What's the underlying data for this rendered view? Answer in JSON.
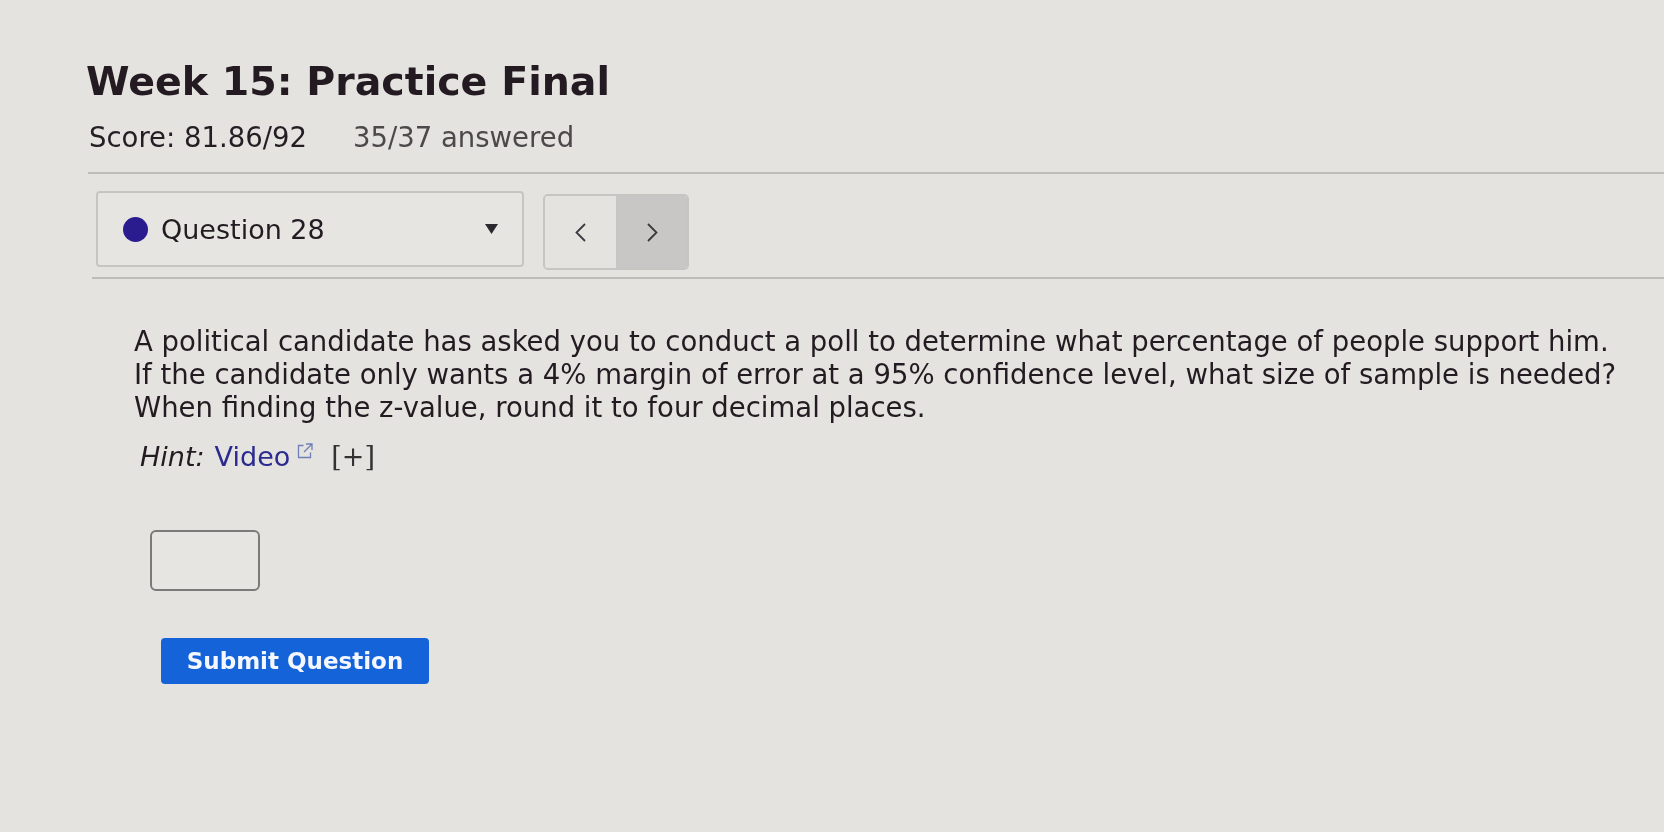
{
  "header": {
    "title": "Week 15: Practice Final",
    "score": "Score: 81.86/92",
    "progress": "35/37 answered"
  },
  "question_nav": {
    "color": "#2a1c8f",
    "label": "Question 28",
    "buttons": [
      {
        "kind": "previous",
        "highlighted": false
      },
      {
        "kind": "next",
        "highlighted": true
      }
    ]
  },
  "question": {
    "sentences": [
      "A political candidate has asked you to conduct a poll to determine what percentage of people support him.",
      "If the candidate only wants a 4% margin of error at a 95% confidence level, what size of sample is needed?",
      "When finding the z-value, round it to four decimal places."
    ],
    "hint": {
      "label": "Hint:",
      "link": "Video",
      "expand": "[+]"
    }
  },
  "submit": {
    "label": "Submit Question"
  }
}
